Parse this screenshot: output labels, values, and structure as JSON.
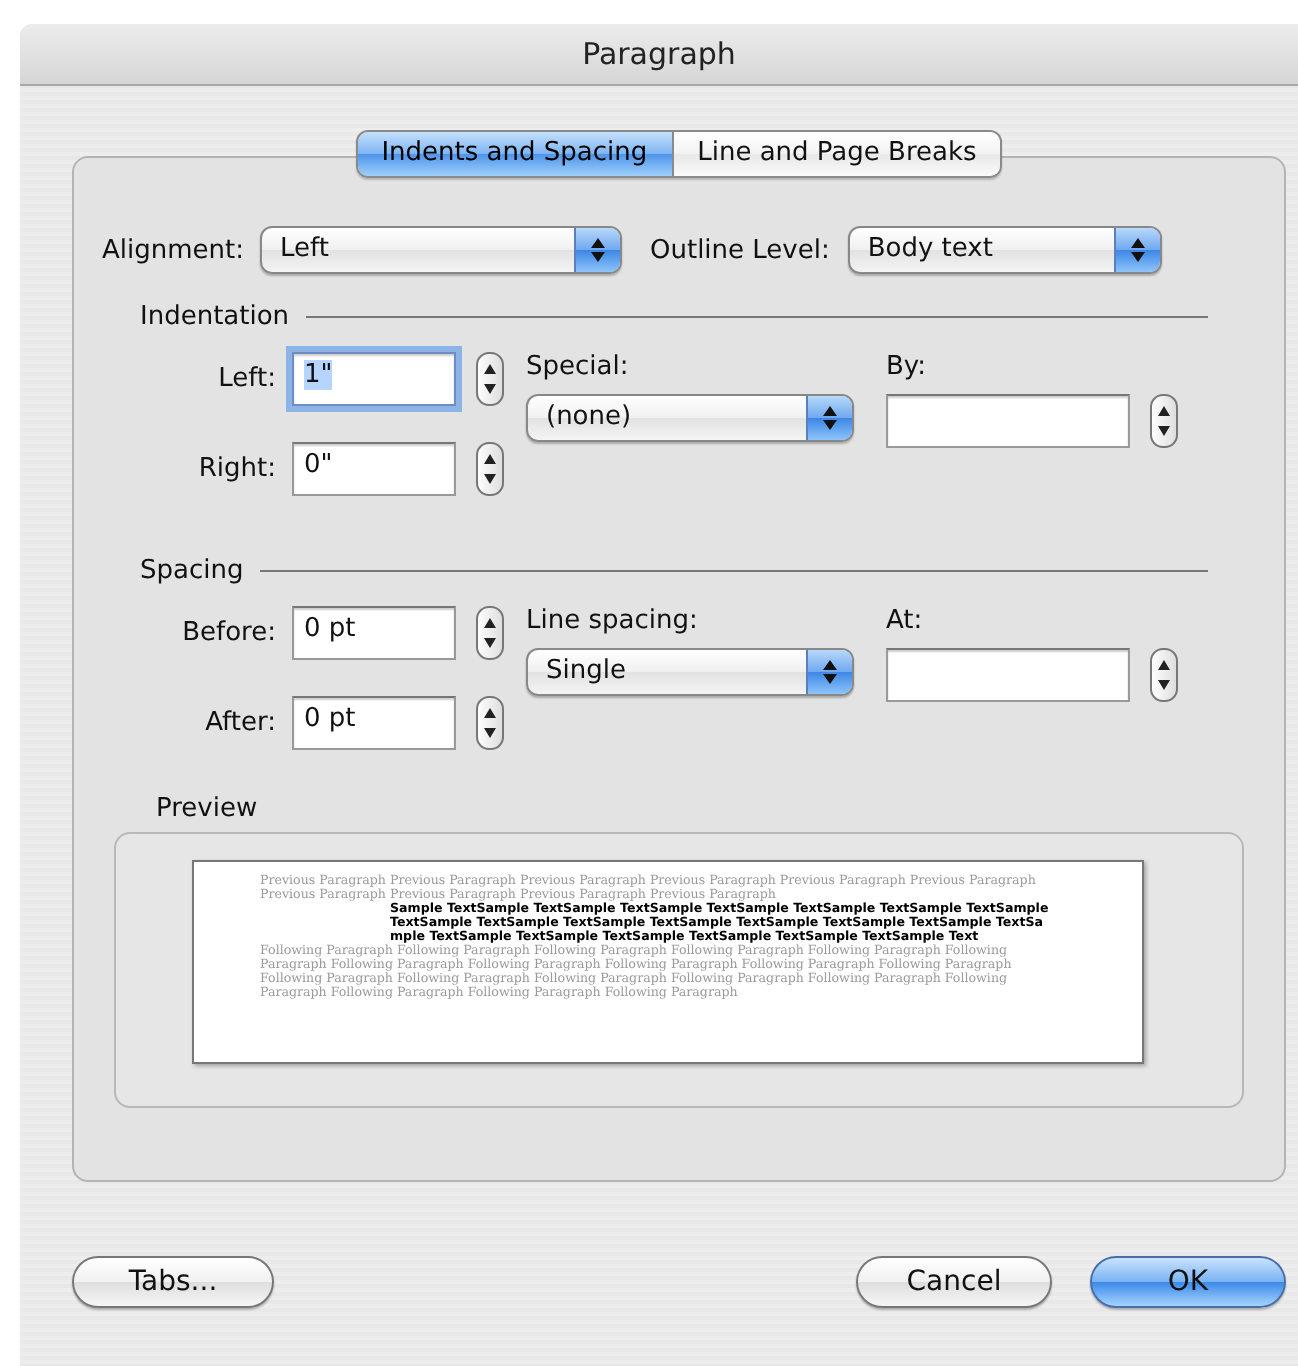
{
  "window": {
    "title": "Paragraph"
  },
  "tabs": [
    {
      "label": "Indents and Spacing",
      "selected": true
    },
    {
      "label": "Line and Page Breaks",
      "selected": false
    }
  ],
  "alignment": {
    "label": "Alignment:",
    "value": "Left"
  },
  "outline_level": {
    "label": "Outline Level:",
    "value": "Body text"
  },
  "indentation": {
    "heading": "Indentation",
    "fields": [
      {
        "label": "Left:",
        "value": "1\"",
        "focused": true
      },
      {
        "label": "Right:",
        "value": "0\"",
        "focused": false
      }
    ],
    "special": {
      "label": "Special:",
      "value": "(none)"
    },
    "by": {
      "label": "By:"
    }
  },
  "spacing": {
    "heading": "Spacing",
    "fields": [
      {
        "label": "Before:",
        "value": "0 pt",
        "focused": false
      },
      {
        "label": "After:",
        "value": "0 pt",
        "focused": false
      }
    ],
    "special": {
      "label": "Line spacing:",
      "value": "Single"
    },
    "by": {
      "label": "At:"
    }
  },
  "preview": {
    "label": "Preview",
    "previous_text": "Previous Paragraph Previous Paragraph Previous Paragraph Previous Paragraph Previous Paragraph Previous Paragraph Previous Paragraph Previous Paragraph Previous Paragraph Previous Paragraph",
    "sample_text": "Sample TextSample TextSample TextSample TextSample TextSample TextSample TextSample TextSample TextSample TextSample TextSample TextSample TextSample TextSample TextSample TextSample TextSample TextSample TextSample TextSample TextSample Text",
    "following_text": "Following Paragraph Following Paragraph Following Paragraph Following Paragraph Following Paragraph Following Paragraph Following Paragraph Following Paragraph Following Paragraph Following Paragraph Following Paragraph Following Paragraph Following Paragraph Following Paragraph Following Paragraph Following Paragraph Following Paragraph Following Paragraph Following Paragraph Following Paragraph"
  },
  "buttons": [
    {
      "label": "Tabs...",
      "kind": "plain"
    },
    {
      "label": "Cancel",
      "kind": "plain"
    },
    {
      "label": "OK",
      "kind": "default"
    }
  ]
}
